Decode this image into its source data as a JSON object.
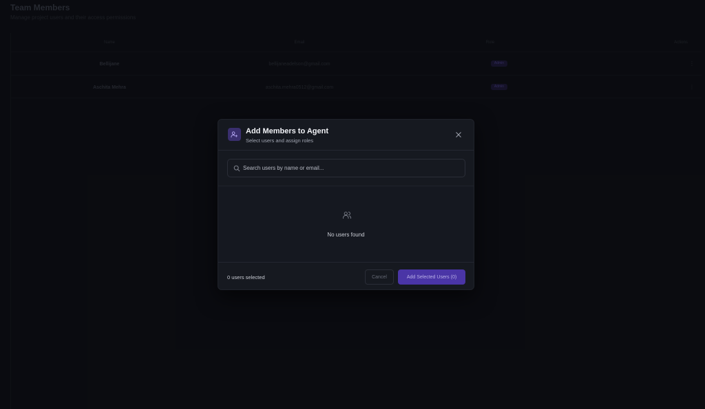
{
  "background": {
    "title": "Team Members",
    "subtitle": "Manage project users and their access permissions",
    "table": {
      "headers": [
        "Name",
        "Email",
        "Role",
        "Actions"
      ],
      "rows": [
        {
          "name": "Bellijane",
          "email": "bellijaneadelson@gmail.com",
          "role": "Admin",
          "action": "⋮"
        },
        {
          "name": "Aschita Mehra",
          "email": "aschita.mehra0512@gmail.com",
          "role": "Admin",
          "action": "⋮"
        }
      ]
    }
  },
  "modal": {
    "icon": "users-plus-icon",
    "title": "Add Members to Agent",
    "subtitle": "Select users and assign roles",
    "search_placeholder": "Search users by name or email...",
    "search_value": "",
    "empty_icon": "users-icon",
    "empty_text": "No users found",
    "selected_count": "0 users selected",
    "cancel_label": "Cancel",
    "add_label": "Add Selected Users (0)"
  },
  "colors": {
    "accent": "#4a35a6",
    "modal_bg": "#161920",
    "page_bg": "#0e0f14"
  }
}
